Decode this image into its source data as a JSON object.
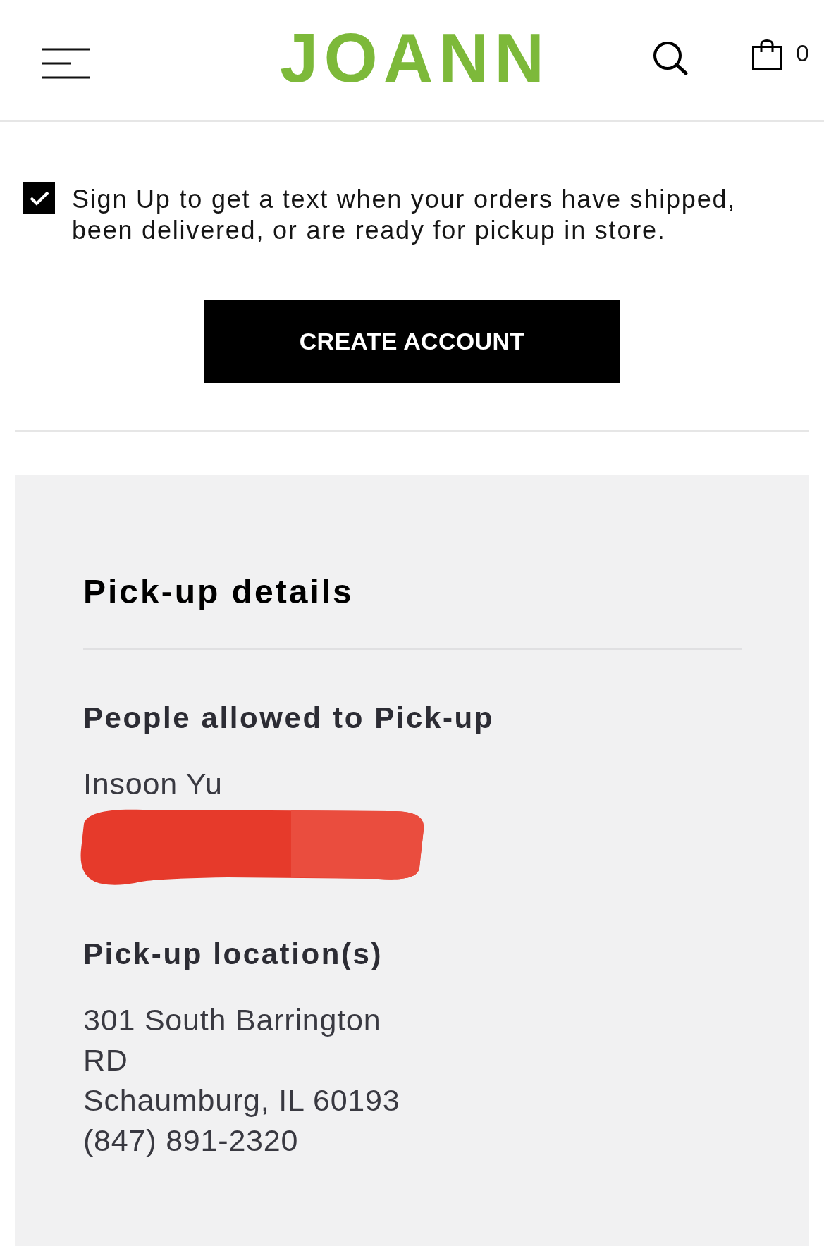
{
  "header": {
    "logo": "JOANN",
    "cart_count": "0"
  },
  "sms_signup": {
    "checked": true,
    "text": "Sign Up to get a text when your orders have shipped, been delivered, or are ready for pickup in store."
  },
  "create_account_button": "CREATE ACCOUNT",
  "pickup_details": {
    "title": "Pick-up details",
    "sections": [
      {
        "heading": "People allowed to Pick-up",
        "lines": [
          "Insoon Yu"
        ],
        "redacted": true
      },
      {
        "heading": "Pick-up location(s)",
        "lines": [
          "301 South Barrington",
          "RD",
          "Schaumburg, IL 60193",
          "(847) 891-2320"
        ]
      }
    ]
  }
}
